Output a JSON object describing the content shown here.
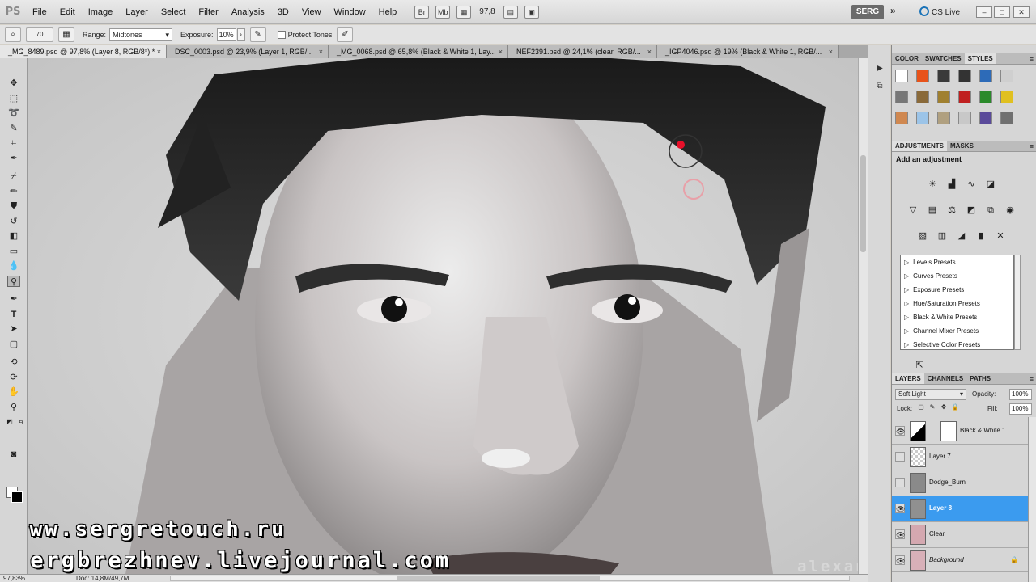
{
  "app": {
    "logo": "PS"
  },
  "menu": [
    "File",
    "Edit",
    "Image",
    "Layer",
    "Select",
    "Filter",
    "Analysis",
    "3D",
    "View",
    "Window",
    "Help"
  ],
  "menubar_extras": {
    "zoom": "97,8",
    "workspace": "SERG",
    "more": "»",
    "cslive": "CS Live"
  },
  "options_bar": {
    "brush_size": "70",
    "range_label": "Range:",
    "range_value": "Midtones",
    "exposure_label": "Exposure:",
    "exposure_value": "10%",
    "protect_tones_label": "Protect Tones",
    "protect_tones_checked": false
  },
  "tabs": [
    {
      "label": "_MG_8489.psd @ 97,8% (Layer 8, RGB/8*) *",
      "active": true
    },
    {
      "label": "DSC_0003.psd @ 23,9% (Layer 1, RGB/...",
      "active": false
    },
    {
      "label": "_MG_0068.psd @ 65,8% (Black & White 1, Lay...",
      "active": false
    },
    {
      "label": "NEF2391.psd @ 24,1% (clear, RGB/...",
      "active": false
    },
    {
      "label": "_IGP4046.psd @ 19% (Black & White 1, RGB/...",
      "active": false
    }
  ],
  "tab_close": "×",
  "canvas": {
    "watermark_1": "www.sergretouch.ru",
    "watermark_2": "sergbrezhnev.livejournal.com",
    "watermark_3": "alexanderkuznetsov"
  },
  "statusbar": {
    "zoom": "97,83%",
    "doc_info": "Doc: 14,8M/49,7M"
  },
  "panels": {
    "top_tabs": [
      "COLOR",
      "SWATCHES",
      "STYLES"
    ],
    "top_active": "STYLES",
    "adjustments_tabs": [
      "ADJUSTMENTS",
      "MASKS"
    ],
    "adjustments_title": "Add an adjustment",
    "presets": [
      "Levels Presets",
      "Curves Presets",
      "Exposure Presets",
      "Hue/Saturation Presets",
      "Black & White Presets",
      "Channel Mixer Presets",
      "Selective Color Presets"
    ],
    "layers_tabs": [
      "LAYERS",
      "CHANNELS",
      "PATHS"
    ],
    "blend_mode": "Soft Light",
    "opacity_label": "Opacity:",
    "opacity_value": "100%",
    "lock_label": "Lock:",
    "fill_label": "Fill:",
    "fill_value": "100%"
  },
  "layers": [
    {
      "name": "Black & White 1",
      "visible": true,
      "active": false,
      "has_mask": true
    },
    {
      "name": "Layer 7",
      "visible": false,
      "active": false,
      "has_mask": false
    },
    {
      "name": "Dodge_Burn",
      "visible": false,
      "active": false,
      "has_mask": false
    },
    {
      "name": "Layer 8",
      "visible": true,
      "active": true,
      "has_mask": false
    },
    {
      "name": "Clear",
      "visible": true,
      "active": false,
      "has_mask": false
    },
    {
      "name": "Background",
      "visible": true,
      "active": false,
      "has_mask": false
    }
  ],
  "colors": {
    "selection_blue": "#3b9bef",
    "brush_cursor_red": "#e8102a"
  },
  "style_swatch_colors": [
    "#ffffff",
    "#e8531a",
    "#3a3a3a",
    "#333333",
    "#2d6bb8",
    "#cfcfcf",
    "#777777",
    "#8a6a3a",
    "#a08030",
    "#c02020",
    "#2a8a2a",
    "#e0c020",
    "#d08850",
    "#9cc4e8",
    "#b0a080",
    "#c8c8c8",
    "#5a4a9a",
    "#707070"
  ]
}
